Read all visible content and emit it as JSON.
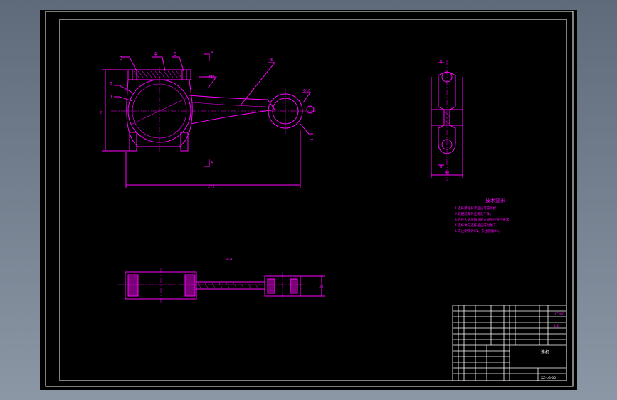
{
  "colors": {
    "background": "#000000",
    "frame": "#ffffff",
    "outline": "#ff00ff",
    "title_text": "#ff00ff"
  },
  "balloons": [
    "3",
    "4",
    "5",
    "6",
    "2",
    "1",
    "7"
  ],
  "section_marks": {
    "top": "A",
    "bottom": "A",
    "side_top": "B",
    "side_bottom": "B"
  },
  "dimensions": {
    "overall_length": "272",
    "side_width": "48",
    "left_height": "80",
    "bolt_tag": "M8",
    "small_end_tag": "Φ18",
    "section_label": "A-A",
    "bottom_side": "33"
  },
  "requirements": {
    "title": "技术要求",
    "lines": [
      "1.连杆螺栓拧紧后应可靠防松。",
      "2.装配前零件应清洗干净。",
      "3.连杆大头与轴颈配合间隙应符合要求。",
      "4.连杆体与连杆盖应成对加工。",
      "5.未注倒角为C1，未注圆角R2。"
    ]
  },
  "title_block": {
    "right_col_1": "HT200",
    "right_col_2": "1:2",
    "company_mark": "连杆",
    "drawing_no": "XZ-LG-00"
  }
}
